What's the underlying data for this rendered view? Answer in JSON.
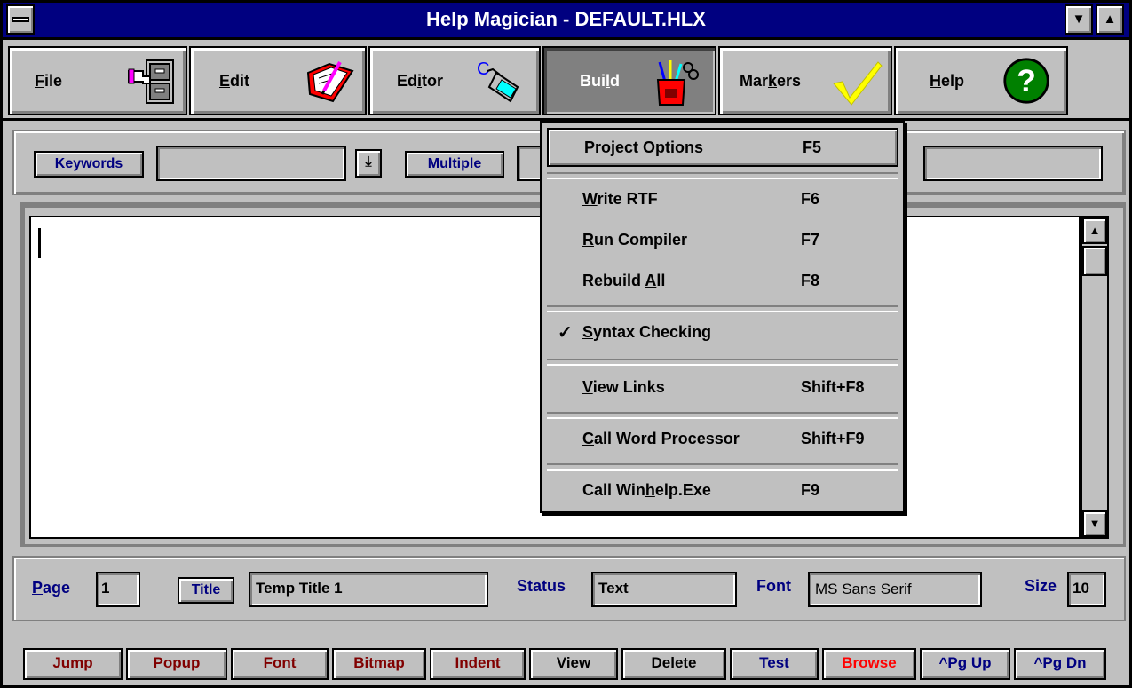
{
  "window": {
    "title": "Help Magician - DEFAULT.HLX"
  },
  "toolbar": [
    {
      "pre": "",
      "ul": "F",
      "post": "ile",
      "icon": "file-cabinet-icon"
    },
    {
      "pre": "",
      "ul": "E",
      "post": "dit",
      "icon": "notebook-pencil-icon"
    },
    {
      "pre": "Ed",
      "ul": "i",
      "post": "tor",
      "icon": "glue-bottle-icon"
    },
    {
      "pre": "Bui",
      "ul": "l",
      "post": "d",
      "icon": "tools-cup-icon"
    },
    {
      "pre": "Mar",
      "ul": "k",
      "post": "ers",
      "icon": "checkmark-icon"
    },
    {
      "pre": "",
      "ul": "H",
      "post": "elp",
      "icon": "question-icon"
    }
  ],
  "search": {
    "keywords_label": "Keywords",
    "keywords_value": "",
    "multiple_label": "Multiple",
    "multiple_value": ""
  },
  "editor": {
    "text": ""
  },
  "status": {
    "page_ul": "P",
    "page_rest": "age",
    "page_value": "1",
    "title_label": "Title",
    "title_value": "Temp Title 1",
    "status_label": "Status",
    "status_value": "Text",
    "font_label": "Font",
    "font_value": "MS Sans Serif",
    "size_label": "Size",
    "size_value": "10"
  },
  "buttons": [
    {
      "label": "Jump",
      "color": "#800000"
    },
    {
      "label": "Popup",
      "color": "#800000"
    },
    {
      "label": "Font",
      "color": "#800000"
    },
    {
      "label": "Bitmap",
      "color": "#800000"
    },
    {
      "label": "Indent",
      "color": "#800000"
    },
    {
      "label": "View",
      "color": "#000000"
    },
    {
      "label": "Delete",
      "color": "#000000"
    },
    {
      "label": "Test",
      "color": "#000080"
    },
    {
      "label": "Browse",
      "color": "#ff0000"
    },
    {
      "label": "^Pg Up",
      "color": "#000080"
    },
    {
      "label": "^Pg Dn",
      "color": "#000080"
    }
  ],
  "menu": {
    "items": [
      {
        "pre": "",
        "ul": "P",
        "post": "roject Options",
        "key": "F5",
        "checked": false
      },
      {
        "pre": "",
        "ul": "W",
        "post": "rite RTF",
        "key": "F6",
        "checked": false
      },
      {
        "pre": "",
        "ul": "R",
        "post": "un Compiler",
        "key": "F7",
        "checked": false
      },
      {
        "pre": "Rebuild ",
        "ul": "A",
        "post": "ll",
        "key": "F8",
        "checked": false
      },
      {
        "pre": "",
        "ul": "S",
        "post": "yntax Checking",
        "key": "",
        "checked": true
      },
      {
        "pre": "",
        "ul": "V",
        "post": "iew Links",
        "key": "Shift+F8",
        "checked": false
      },
      {
        "pre": "",
        "ul": "C",
        "post": "all Word Processor",
        "key": "Shift+F9",
        "checked": false
      },
      {
        "pre": "Call Win",
        "ul": "h",
        "post": "elp.Exe",
        "key": "F9",
        "checked": false
      }
    ]
  }
}
